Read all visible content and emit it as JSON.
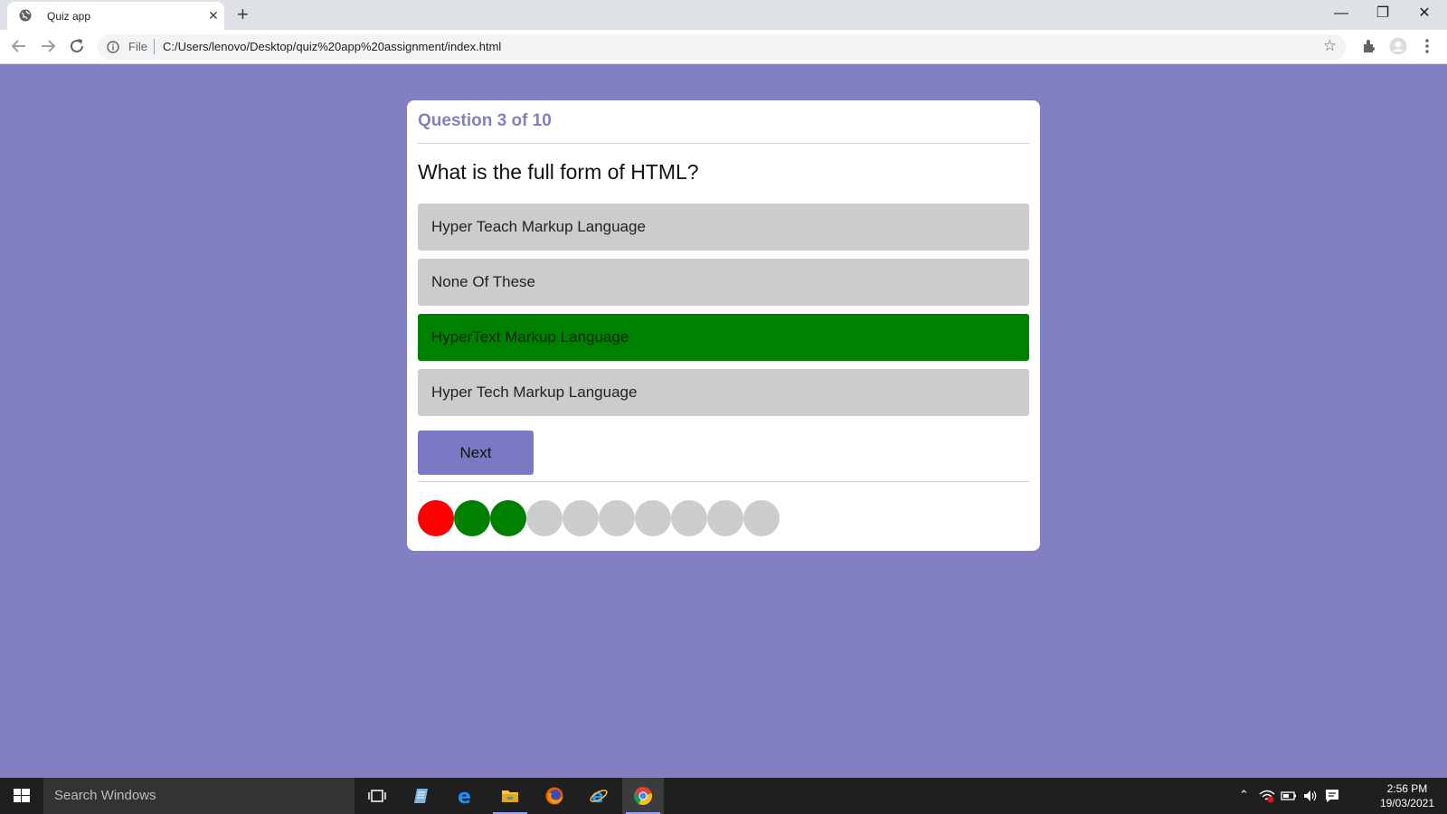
{
  "browser": {
    "tab_title": "Quiz app",
    "tab_close": "✕",
    "new_tab": "+",
    "window_controls": [
      "—",
      "❐",
      "✕"
    ],
    "address_scheme": "File",
    "address_url": "C:/Users/lenovo/Desktop/quiz%20app%20assignment/index.html",
    "icons": [
      "globe-icon",
      "back-icon",
      "forward-icon",
      "reload-icon",
      "info-icon",
      "star-icon",
      "extensions-icon",
      "profile-icon",
      "menu-icon"
    ]
  },
  "quiz": {
    "counter": "Question 3 of 10",
    "question": "What is the full form of HTML?",
    "options": [
      {
        "label": "Hyper Teach Markup Language",
        "state": "default"
      },
      {
        "label": "None Of These",
        "state": "default"
      },
      {
        "label": "HyperText Markup Language",
        "state": "correct"
      },
      {
        "label": "Hyper Tech Markup Language",
        "state": "default"
      }
    ],
    "next_label": "Next",
    "progress": [
      "wrong",
      "correct",
      "correct",
      "unanswered",
      "unanswered",
      "unanswered",
      "unanswered",
      "unanswered",
      "unanswered",
      "unanswered"
    ]
  },
  "colors": {
    "background": "#8280c2",
    "accent": "#8280c2",
    "correct": "#008000",
    "wrong": "#ff0000",
    "neutral": "#cccccc"
  },
  "taskbar": {
    "search_placeholder": "Search Windows",
    "apps": [
      "task-view-icon",
      "notepad-icon",
      "edge-icon",
      "file-explorer-icon",
      "firefox-icon",
      "internet-explorer-icon",
      "chrome-icon"
    ],
    "time": "2:56 PM",
    "date": "19/03/2021"
  }
}
